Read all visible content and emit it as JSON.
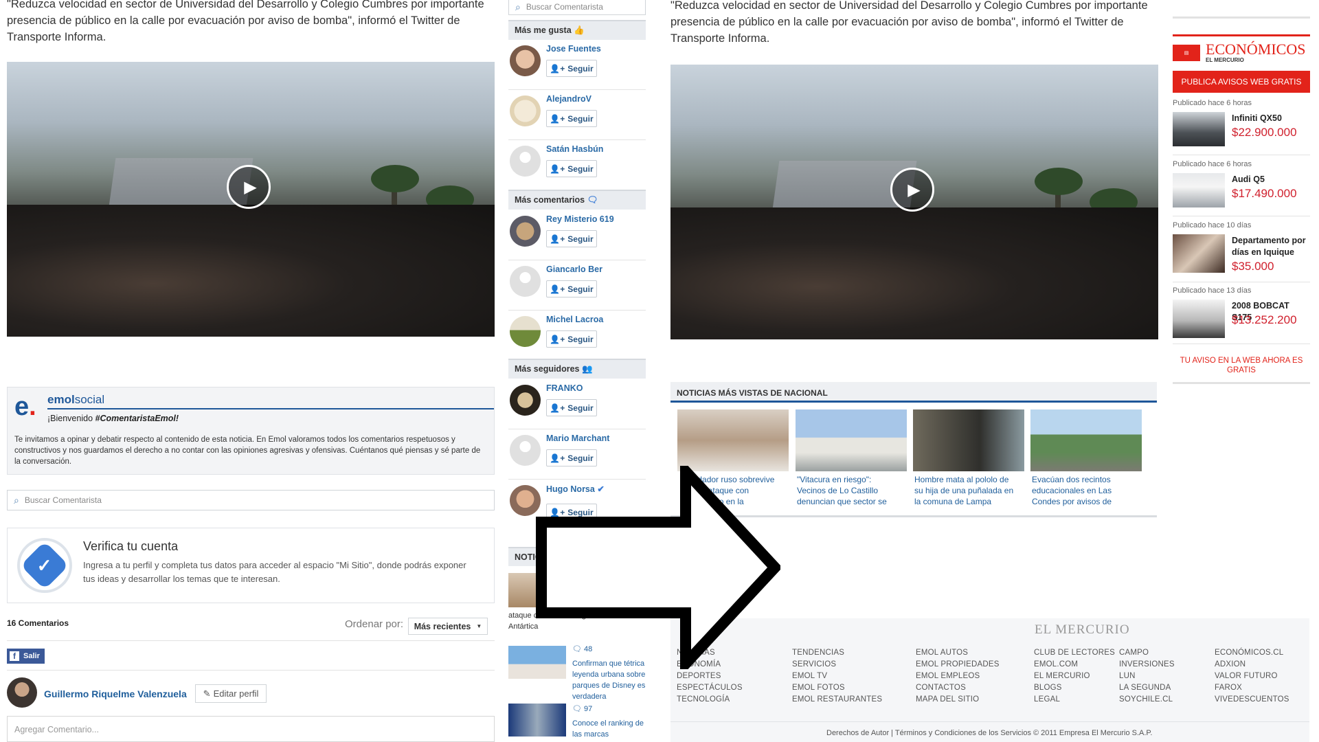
{
  "left_article": {
    "lede": "\"Reduzca velocidad en sector de Universidad del Desarrollo y Colegio Cumbres por importante presencia de público en la calle por evacuación por aviso de bomba\", informó el Twitter de Transporte Informa."
  },
  "emolsocial": {
    "logo_letter": "e",
    "brand_a": "emol",
    "brand_b": "social",
    "welcome_prefix": "¡Bienvenido ",
    "welcome_tag": "#ComentaristaEmol!",
    "intro": "Te invitamos a opinar y debatir respecto al contenido de esta noticia. En Emol valoramos todos los comentarios respetuosos y constructivos y nos guardamos el derecho a no contar con las opiniones agresivas y ofensivas. Cuéntanos qué piensas y sé parte de la conversación.",
    "search_placeholder": "Buscar Comentarista",
    "verify_title": "Verifica tu cuenta",
    "verify_text": "Ingresa a tu perfil y completa tus datos para acceder al espacio \"Mi Sitio\", donde podrás exponer tus ideas y desarrollar los temas que te interesan.",
    "comments_count": "16 Comentarios",
    "order_label": "Ordenar por:",
    "order_value": "Más recientes",
    "fb_label": "Salir",
    "user_name": "Guillermo Riquelme Valenzuela",
    "edit_profile": "Editar perfil",
    "comment_placeholder": "Agregar Comentario..."
  },
  "sidebar": {
    "search_placeholder": "Buscar Comentarista",
    "follow_label": "Seguir",
    "mas_me_gusta": {
      "title": "Más me gusta",
      "users": [
        "Jose Fuentes",
        "AlejandroV",
        "Satán Hasbún"
      ]
    },
    "mas_comentarios": {
      "title": "Más comentarios",
      "users": [
        "Rey Misterio 619",
        "Giancarlo Ber",
        "Michel Lacroa"
      ]
    },
    "mas_seguidores": {
      "title": "Más seguidores",
      "users": [
        "FRANKO",
        "Mario Marchant",
        "Hugo Norsa"
      ]
    },
    "noticias_title": "NOTIC",
    "news": [
      {
        "text": "ataque con cuchillo registrado en la Antártica"
      },
      {
        "count": "48",
        "text": "Confirman que tétrica leyenda urbana sobre parques de Disney es verdadera"
      },
      {
        "count": "97",
        "text": "Conoce el ranking de las marcas"
      }
    ]
  },
  "right_article": {
    "lede": "\"Reduzca velocidad en sector de Universidad del Desarrollo y Colegio Cumbres por importante presencia de público en la calle por evacuación por aviso de bomba\", informó el Twitter de Transporte Informa."
  },
  "mas_vistas": {
    "title": "NOTICIAS MÁS VISTAS DE NACIONAL",
    "items": [
      "Ex soldador ruso sobrevive ... tener ataque con ... registrado en la",
      "\"Vitacura en riesgo\": Vecinos de Lo Castillo denuncian que sector se",
      "Hombre mata al pololo de su hija de una puñalada en la comuna de Lampa",
      "Evacúan dos recintos educacionales en Las Condes por avisos de"
    ],
    "item_texts": [
      "soldador ruso sobrevive",
      "tener ataque con",
      "registrado en la"
    ]
  },
  "economicos": {
    "brand": "ECONÓMICOS",
    "brand_sub": "EL MERCURIO",
    "cta": "PUBLICA AVISOS WEB GRATIS",
    "items": [
      {
        "when": "Publicado hace 6 horas",
        "title": "Infiniti QX50",
        "price": "$22.900.000"
      },
      {
        "when": "Publicado hace 6 horas",
        "title": "Audi Q5",
        "price": "$17.490.000"
      },
      {
        "when": "Publicado hace 10 días",
        "title": "Departamento por días en Iquique",
        "price": "$35.000"
      },
      {
        "when": "Publicado hace 13 días",
        "title": "2008 BOBCAT S175",
        "price": "$13.252.200"
      }
    ],
    "footer_cta": "TU AVISO EN LA WEB AHORA ES GRATIS"
  },
  "footer": {
    "brand": "EL MERCURIO",
    "columns": [
      [
        "NOTICIAS",
        "ECONOMÍA",
        "DEPORTES",
        "ESPECTÁCULOS",
        "TECNOLOGÍA"
      ],
      [
        "TENDENCIAS",
        "SERVICIOS",
        "EMOL TV",
        "EMOL FOTOS",
        "EMOL RESTAURANTES"
      ],
      [
        "EMOL AUTOS",
        "EMOL PROPIEDADES",
        "EMOL EMPLEOS",
        "CONTACTOS",
        "MAPA DEL SITIO"
      ],
      [
        "CLUB DE LECTORES",
        "EMOL.COM",
        "EL MERCURIO",
        "BLOGS",
        "LEGAL"
      ],
      [
        "CAMPO",
        "INVERSIONES",
        "LUN",
        "LA SEGUNDA",
        "SOYCHILE.CL"
      ],
      [
        "ECONÓMICOS.CL",
        "ADXION",
        "VALOR FUTURO",
        "FAROX",
        "VIVEDESCUENTOS"
      ]
    ],
    "copyright": "Derechos de Autor | Términos y Condiciones de los Servicios © 2011 Empresa El Mercurio S.A.P."
  },
  "icons": {
    "play": "play-icon",
    "search": "search-icon",
    "follow": "add-user-icon",
    "arrow": "arrow-right-icon"
  },
  "colors": {
    "link_blue": "#2a6aa6",
    "price_red": "#d0202d",
    "econ_red": "#e2231a",
    "emol_blue": "#1e5799"
  }
}
